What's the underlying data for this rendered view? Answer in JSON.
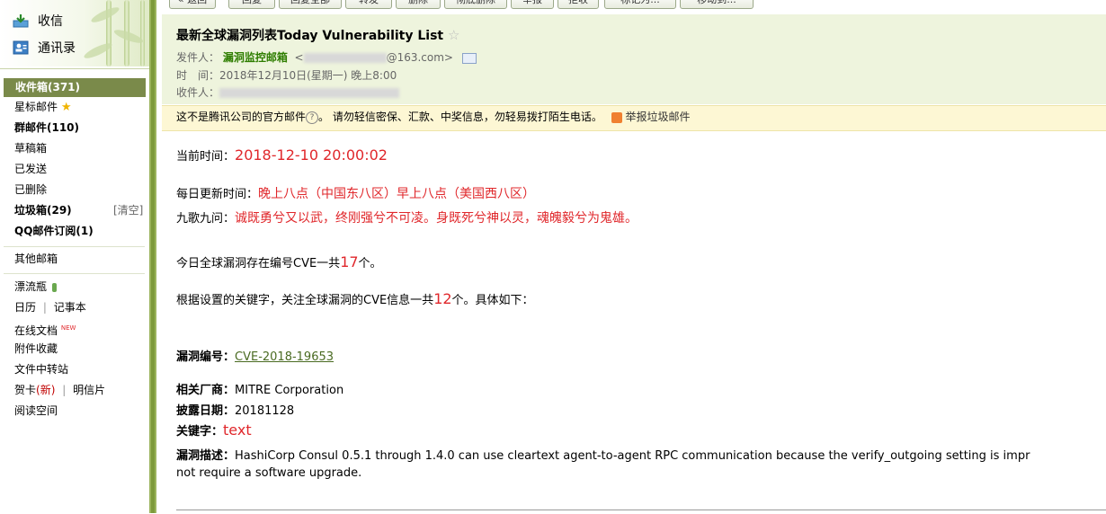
{
  "sidebar": {
    "top_nav": [
      {
        "label": "收信",
        "icon": "inbox-download-icon"
      },
      {
        "label": "通讯录",
        "icon": "contacts-icon"
      }
    ],
    "folders": [
      {
        "label": "收件箱(371)",
        "bold": true,
        "selected": true
      },
      {
        "label": "星标邮件",
        "icon": "star-icon"
      },
      {
        "label": "群邮件(110)",
        "bold": true
      },
      {
        "label": "草稿箱"
      },
      {
        "label": "已发送"
      },
      {
        "label": "已删除"
      },
      {
        "label": "垃圾箱(29)",
        "bold": true,
        "action": "[清空]"
      },
      {
        "label": "QQ邮件订阅(1)",
        "bold": true
      }
    ],
    "other_mailbox": "其他邮箱",
    "apps": {
      "drift_bottle": "漂流瓶",
      "calendar": "日历",
      "notes": "记事本",
      "online_docs": "在线文档",
      "new_badge": "NEW",
      "attachments": "附件收藏",
      "file_transfer": "文件中转站",
      "greeting_card": "贺卡",
      "greeting_new": "(新)",
      "postcard": "明信片",
      "reading": "阅读空间"
    }
  },
  "toolbar": {
    "back": "« 返回",
    "reply": "回复",
    "reply_all": "回复全部",
    "forward": "转发",
    "delete": "删除",
    "delete_perm": "彻底删除",
    "report": "举报",
    "reject": "拒收",
    "mark_as": "标记为...",
    "move_to": "移动到..."
  },
  "mail": {
    "subject": "最新全球漏洞列表Today Vulnerability List",
    "from_label": "发件人：",
    "from_name": "漏洞监控邮箱",
    "from_addr_suffix": "@163.com>",
    "time_label": "时　间：",
    "time": "2018年12月10日(星期一) 晚上8:00",
    "to_label": "收件人：",
    "warning": "这不是腾讯公司的官方邮件",
    "warning_detail": "。  请勿轻信密保、汇款、中奖信息，勿轻易拨打陌生电话。",
    "report_spam": "举报垃圾邮件"
  },
  "content": {
    "current_time_label": "当前时间：",
    "current_time": "2018-12-10 20:00:02",
    "update_label": "每日更新时间：",
    "update_value": "晚上八点（中国东八区）早上八点（美国西八区）",
    "poem_label": "九歌九问：",
    "poem": "诚既勇兮又以武，终刚强兮不可凌。身既死兮神以灵，魂魄毅兮为鬼雄。",
    "today_prefix": "今日全球漏洞存在编号CVE一共",
    "today_count": "17",
    "today_suffix": "个。",
    "kw_prefix": "根据设置的关键字，关注全球漏洞的CVE信息一共",
    "kw_count": "12",
    "kw_suffix": "个。具体如下：",
    "vuln_id_label": "漏洞编号：",
    "vuln_id": "CVE-2018-19653",
    "vendor_label": "相关厂商：",
    "vendor": "MITRE Corporation",
    "date_label": "披露日期：",
    "date": "20181128",
    "keyword_label": "关键字：",
    "keyword": "text",
    "desc_label": "漏洞描述：",
    "desc_line1": "HashiCorp Consul 0.5.1 through 1.4.0 can use cleartext agent-to-agent RPC communication because the verify_outgoing setting is impr",
    "desc_line2": "not require a software upgrade."
  }
}
